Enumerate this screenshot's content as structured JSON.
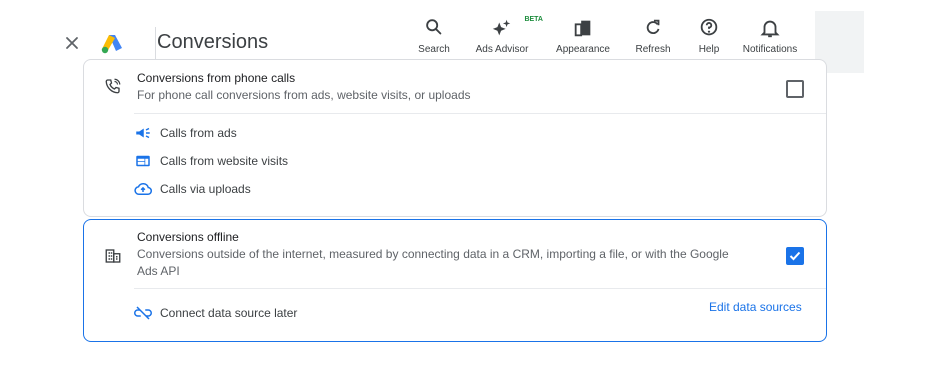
{
  "header": {
    "title": "Conversions",
    "tools": [
      {
        "label": "Search",
        "icon": "search-icon"
      },
      {
        "label": "Ads Advisor",
        "icon": "sparkle-icon",
        "badge": "BETA"
      },
      {
        "label": "Appearance",
        "icon": "appearance-icon"
      },
      {
        "label": "Refresh",
        "icon": "refresh-icon"
      },
      {
        "label": "Help",
        "icon": "help-icon"
      },
      {
        "label": "Notifications",
        "icon": "bell-icon"
      }
    ]
  },
  "phone_calls": {
    "title": "Conversions from phone calls",
    "description": "For phone call conversions from ads, website visits, or uploads",
    "checked": false,
    "items": [
      {
        "label": "Calls from ads",
        "icon": "megaphone-icon"
      },
      {
        "label": "Calls from website visits",
        "icon": "web-icon"
      },
      {
        "label": "Calls via uploads",
        "icon": "cloud-upload-icon"
      }
    ]
  },
  "offline": {
    "title": "Conversions offline",
    "description_line1": "Conversions outside of the internet, measured by connecting data in a CRM, importing a file, or with the Google",
    "description_line2": "Ads API",
    "checked": true,
    "later_label": "Connect data source later",
    "edit_link": "Edit data sources"
  },
  "colors": {
    "accent": "#1a73e8",
    "beta": "#1e8e3e"
  }
}
